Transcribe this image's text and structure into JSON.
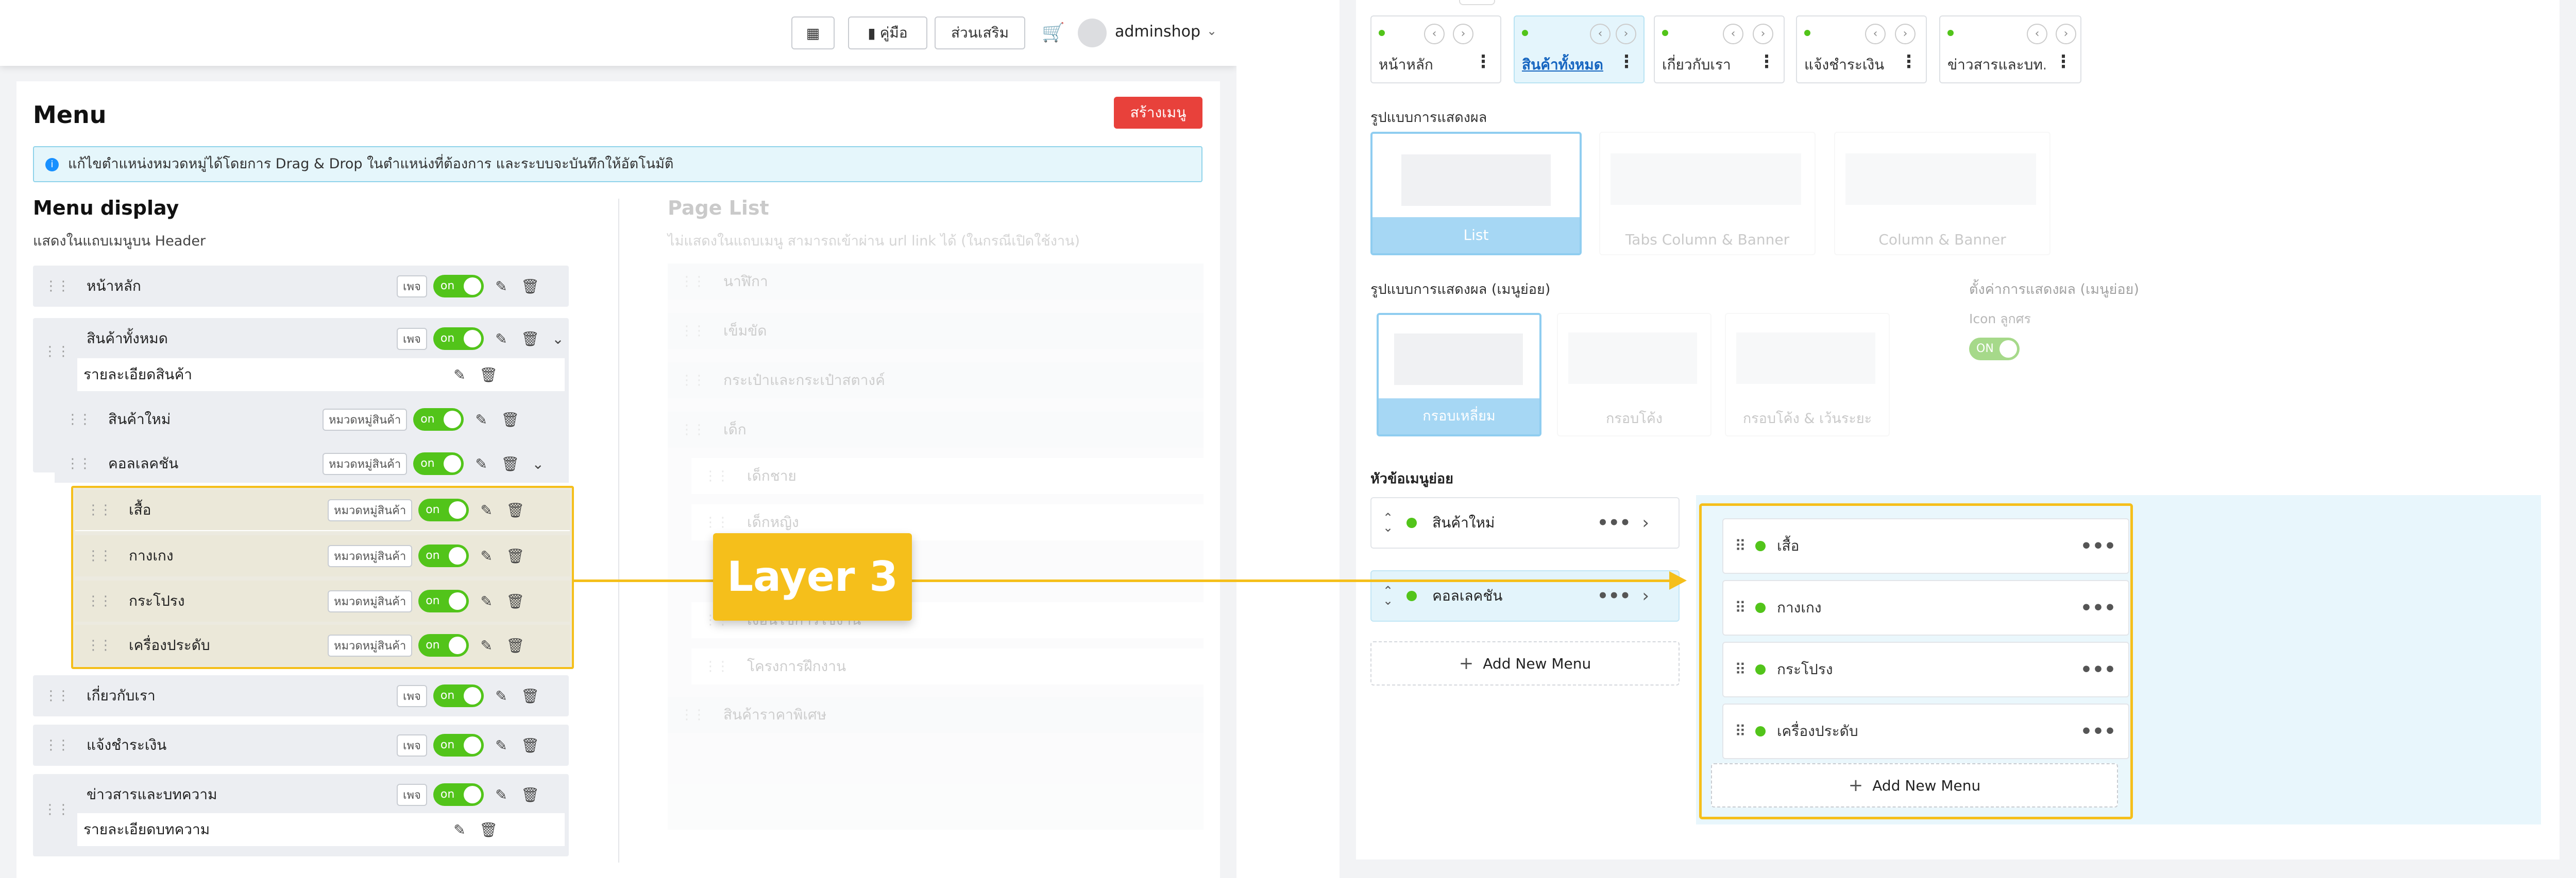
{
  "topbar": {
    "grid_btn": "▦",
    "manual_btn": "คู่มือ",
    "addon_btn": "ส่วนเสริม",
    "username": "adminshop"
  },
  "page": {
    "title": "Menu",
    "create_btn": "สร้างเมนู",
    "info": "แก้ไขตำแหน่งหมวดหมู่ได้โดยการ Drag & Drop ในตำแหน่งที่ต้องการ และระบบจะบันทึกให้อัตโนมัติ",
    "menu_display_title": "Menu display",
    "menu_display_sub": "แสดงในแถบเมนูบน Header",
    "page_list_title": "Page List",
    "page_list_sub": "ไม่แสดงในแถบเมนู สามารถเข้าผ่าน url link ได้ (ในกรณีเปิดใช้งาน)"
  },
  "toggle_on": "on",
  "tag_page": "เพจ",
  "tag_category": "หมวดหมู่สินค้า",
  "menu_items": [
    {
      "label": "หน้าหลัก"
    },
    {
      "label": "สินค้าทั้งหมด"
    },
    {
      "label": "รายละเอียดสินค้า"
    },
    {
      "label": "สินค้าใหม่"
    },
    {
      "label": "คอลเลคชัน"
    },
    {
      "label": "เสื้อ"
    },
    {
      "label": "กางเกง"
    },
    {
      "label": "กระโปรง"
    },
    {
      "label": "เครื่องประดับ"
    },
    {
      "label": "เกี่ยวกับเรา"
    },
    {
      "label": "แจ้งชำระเงิน"
    },
    {
      "label": "ข่าวสารและบทความ"
    },
    {
      "label": "รายละเอียดบทความ"
    }
  ],
  "page_list": [
    {
      "label": "นาฬิกา"
    },
    {
      "label": "เข็มขัด"
    },
    {
      "label": "กระเป๋าและกระเป๋าสตางค์"
    },
    {
      "label": "เด็ก"
    },
    {
      "label": "เด็กชาย"
    },
    {
      "label": "เด็กหญิง"
    },
    {
      "label": "เงื่อนไขการใช้งาน"
    },
    {
      "label": "โครงการฝึกงาน"
    },
    {
      "label": "สินค้าราคาพิเศษ"
    }
  ],
  "layer_label": "Layer 3",
  "tabs": [
    {
      "label": "หน้าหลัก"
    },
    {
      "label": "สินค้าทั้งหมด"
    },
    {
      "label": "เกี่ยวกับเรา"
    },
    {
      "label": "แจ้งชำระเงิน"
    },
    {
      "label": "ข่าวสารและบท.."
    }
  ],
  "display": {
    "title": "รูปแบบการแสดงผล",
    "options": [
      "List",
      "Tabs Column & Banner",
      "Column & Banner"
    ],
    "sub_title": "รูปแบบการแสดงผล (เมนูย่อย)",
    "sub_options": [
      "กรอบเหลี่ยม",
      "กรอบโค้ง",
      "กรอบโค้ง & เว้นระยะ"
    ],
    "settings_title": "ตั้งค่าการแสดงผล (เมนูย่อย)",
    "icon_label": "Icon ลูกศร",
    "icon_toggle": "ON"
  },
  "submenu": {
    "title": "หัวข้อเมนูย่อย",
    "items": [
      "สินค้าใหม่",
      "คอลเลคชัน"
    ],
    "add_btn": "Add New Menu",
    "layer3_items": [
      "เสื้อ",
      "กางเกง",
      "กระโปรง",
      "เครื่องประดับ"
    ],
    "layer3_add_btn": "Add New Menu"
  },
  "colors": {
    "accent": "#f5bf1b",
    "toggle": "#52c41a",
    "create": "#e8413b",
    "info_bg": "#e5f6fb"
  }
}
